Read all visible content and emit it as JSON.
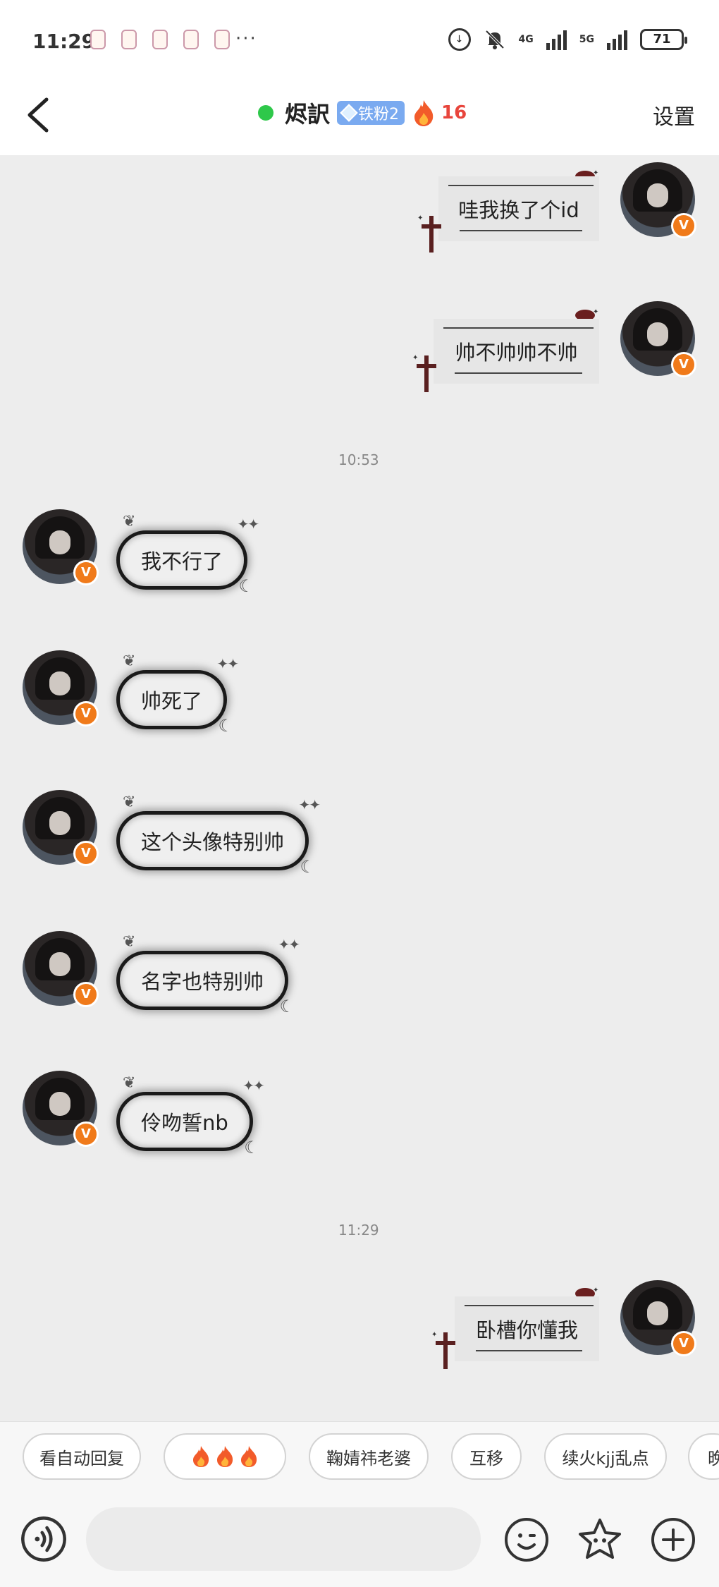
{
  "status_bar": {
    "time": "11:29",
    "more": "···",
    "network_4g": "4G",
    "network_5g": "5G",
    "battery": "71"
  },
  "header": {
    "name": "烬訳",
    "fan_badge": "铁粉2",
    "fire_count": "16",
    "settings": "设置"
  },
  "messages": [
    {
      "text": "哇我换了个id"
    },
    {
      "text": "帅不帅帅不帅"
    },
    {
      "time": "10:53"
    },
    {
      "text": "我不行了"
    },
    {
      "text": "帅死了"
    },
    {
      "text": "这个头像特别帅"
    },
    {
      "text": "名字也特别帅"
    },
    {
      "text": "伶吻誓nb"
    },
    {
      "time": "11:29"
    },
    {
      "text": "卧槽你懂我"
    }
  ],
  "quick_replies": [
    "看自动回复",
    "",
    "鞠婧祎老婆",
    "互移",
    "续火kjj乱点",
    "晚"
  ],
  "colors": {
    "online": "#2ec84a",
    "badge": "#7aaaf0",
    "fire": "#e8453c",
    "vip": "#f07a1a"
  }
}
